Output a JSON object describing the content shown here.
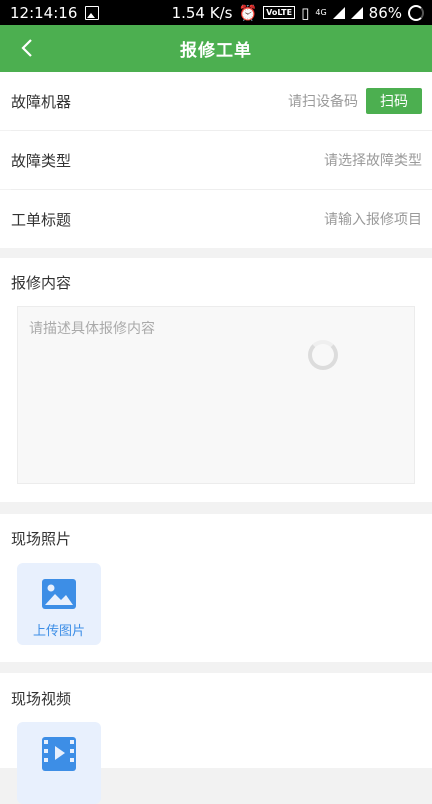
{
  "status_bar": {
    "time": "12:14:16",
    "speed": "1.54 K/s",
    "volte": "VoLTE",
    "network": "4G",
    "battery": "86%"
  },
  "app_bar": {
    "title": "报修工单",
    "back_icon": "chevron-left-icon"
  },
  "form": {
    "machine": {
      "label": "故障机器",
      "placeholder": "请扫设备码",
      "scan_label": "扫码"
    },
    "fault_type": {
      "label": "故障类型",
      "placeholder": "请选择故障类型"
    },
    "ticket_title": {
      "label": "工单标题",
      "placeholder": "请输入报修项目"
    },
    "content": {
      "label": "报修内容",
      "placeholder": "请描述具体报修内容"
    },
    "photos": {
      "label": "现场照片",
      "upload_label": "上传图片"
    },
    "videos": {
      "label": "现场视频"
    }
  },
  "colors": {
    "primary": "#4caf50",
    "upload_bg": "#e8f0fd",
    "upload_icon": "#3d8ee6"
  }
}
